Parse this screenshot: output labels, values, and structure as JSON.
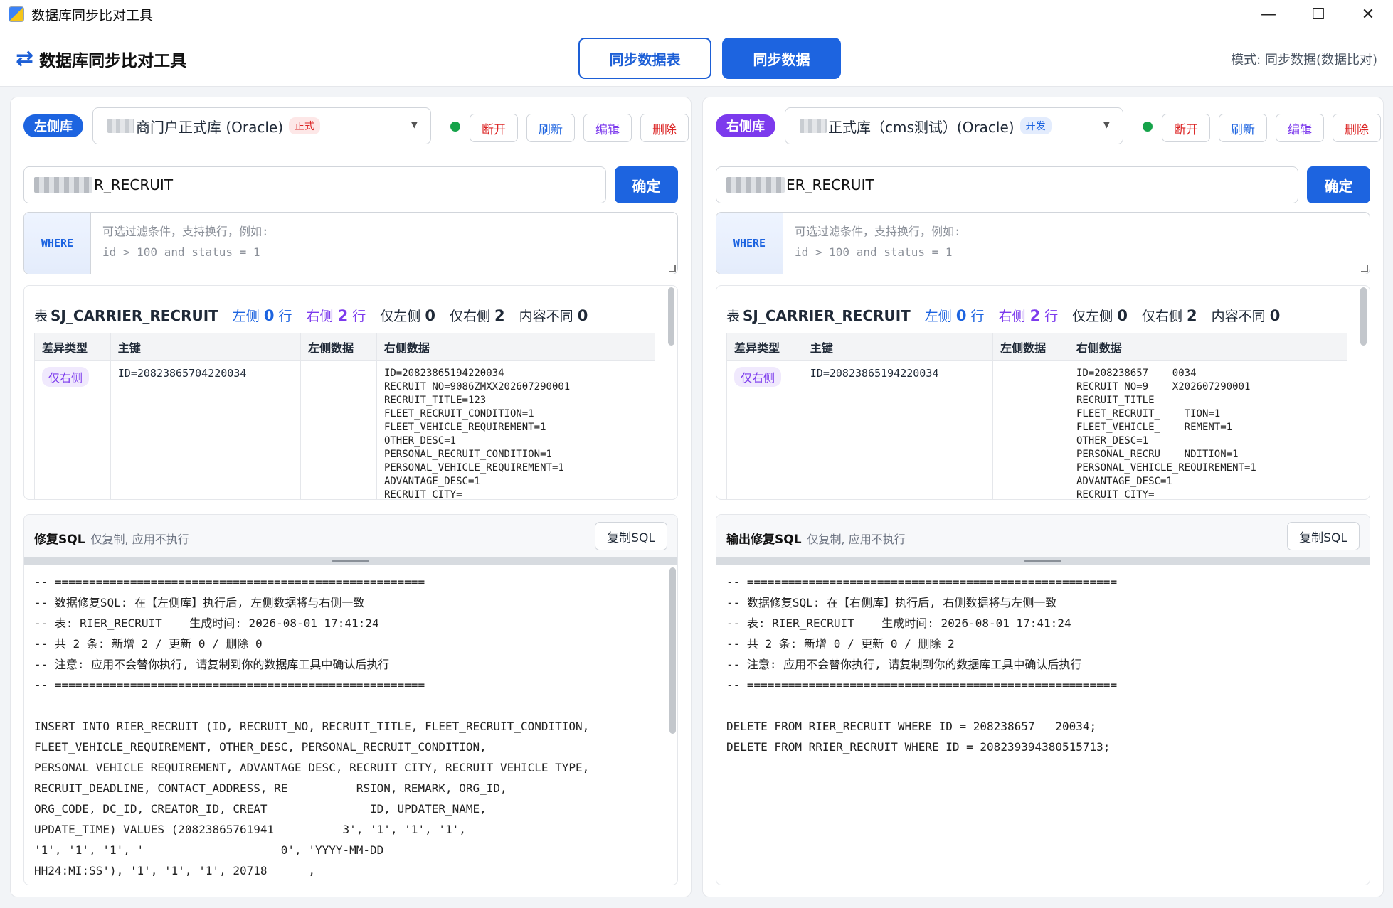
{
  "window": {
    "title": "数据库同步比对工具",
    "min": "—",
    "max": "☐",
    "close": "✕"
  },
  "header": {
    "brand": "数据库同步比对工具",
    "tabs": [
      {
        "label": "同步数据表"
      },
      {
        "label": "同步数据"
      }
    ],
    "mode": "模式: 同步数据(数据比对)"
  },
  "left": {
    "side_badge": "左侧库",
    "db_name": "商门户正式库 (Oracle)",
    "env": "正式",
    "status_color": "#16a34a",
    "buttons": {
      "disconnect": "断开",
      "refresh": "刷新",
      "edit": "编辑",
      "delete": "删除"
    },
    "table_input": "R_RECRUIT",
    "confirm": "确定",
    "where_label": "WHERE",
    "where_placeholder": "可选过滤条件，支持换行，例如:\nid > 100 and status = 1",
    "summary": {
      "prefix": "表",
      "table": "SJ_CARRIER_RECRUIT",
      "left_label": "左侧",
      "left_count": "0",
      "left_unit": "行",
      "right_label": "右侧",
      "right_count": "2",
      "right_unit": "行",
      "only_left_label": "仅左侧",
      "only_left": "0",
      "only_right_label": "仅右侧",
      "only_right": "2",
      "diff_label": "内容不同",
      "diff": "0"
    },
    "columns": [
      "差异类型",
      "主键",
      "左侧数据",
      "右侧数据"
    ],
    "row": {
      "type": "仅右侧",
      "pk": "ID=20823865704220034",
      "right_data": "ID=20823865194220034\nRECRUIT_NO=9086ZMXX202607290001\nRECRUIT_TITLE=123\nFLEET_RECRUIT_CONDITION=1\nFLEET_VEHICLE_REQUIREMENT=1\nOTHER_DESC=1\nPERSONAL_RECRUIT_CONDITION=1\nPERSONAL_VEHICLE_REQUIREMENT=1\nADVANTAGE_DESC=1\nRECRUIT_CITY="
    },
    "sql": {
      "title": "修复SQL",
      "subtitle": "仅复制, 应用不执行",
      "copy": "复制SQL",
      "code": "-- ======================================================\n-- 数据修复SQL: 在【左侧库】执行后, 左侧数据将与右侧一致\n-- 表: RIER_RECRUIT    生成时间: 2026-08-01 17:41:24\n-- 共 2 条: 新增 2 / 更新 0 / 删除 0\n-- 注意: 应用不会替你执行, 请复制到你的数据库工具中确认后执行\n-- ======================================================\n\nINSERT INTO RIER_RECRUIT (ID, RECRUIT_NO, RECRUIT_TITLE, FLEET_RECRUIT_CONDITION,\nFLEET_VEHICLE_REQUIREMENT, OTHER_DESC, PERSONAL_RECRUIT_CONDITION,\nPERSONAL_VEHICLE_REQUIREMENT, ADVANTAGE_DESC, RECRUIT_CITY, RECRUIT_VEHICLE_TYPE,\nRECRUIT_DEADLINE, CONTACT_ADDRESS, RE          RSION, REMARK, ORG_ID,\nORG_CODE, DC_ID, CREATOR_ID, CREAT               ID, UPDATER_NAME,\nUPDATE_TIME) VALUES (20823865761941          3', '1', '1', '1',\n'1', '1', '1', '                    0', 'YYYY-MM-DD\nHH24:MI:SS'), '1', '1', '1', 20718      ,"
    }
  },
  "right": {
    "side_badge": "右侧库",
    "db_name": "正式库（cms测试）(Oracle)",
    "env": "开发",
    "status_color": "#16a34a",
    "buttons": {
      "disconnect": "断开",
      "refresh": "刷新",
      "edit": "编辑",
      "delete": "删除"
    },
    "table_input": "ER_RECRUIT",
    "confirm": "确定",
    "where_label": "WHERE",
    "where_placeholder": "可选过滤条件，支持换行，例如:\nid > 100 and status = 1",
    "summary": {
      "prefix": "表",
      "table": "SJ_CARRIER_RECRUIT",
      "left_label": "左侧",
      "left_count": "0",
      "left_unit": "行",
      "right_label": "右侧",
      "right_count": "2",
      "right_unit": "行",
      "only_left_label": "仅左侧",
      "only_left": "0",
      "only_right_label": "仅右侧",
      "only_right": "2",
      "diff_label": "内容不同",
      "diff": "0"
    },
    "columns": [
      "差异类型",
      "主键",
      "左侧数据",
      "右侧数据"
    ],
    "row": {
      "type": "仅右侧",
      "pk": "ID=20823865194220034",
      "right_data": "ID=208238657    0034\nRECRUIT_NO=9    X202607290001\nRECRUIT_TITLE\nFLEET_RECRUIT_    TION=1\nFLEET_VEHICLE_    REMENT=1\nOTHER_DESC=1\nPERSONAL_RECRU    NDITION=1\nPERSONAL_VEHICLE_REQUIREMENT=1\nADVANTAGE_DESC=1\nRECRUIT_CITY="
    },
    "sql": {
      "title": "输出修复SQL",
      "subtitle": "仅复制, 应用不执行",
      "copy": "复制SQL",
      "code": "-- ======================================================\n-- 数据修复SQL: 在【右侧库】执行后, 右侧数据将与左侧一致\n-- 表: RIER_RECRUIT    生成时间: 2026-08-01 17:41:24\n-- 共 2 条: 新增 0 / 更新 0 / 删除 2\n-- 注意: 应用不会替你执行, 请复制到你的数据库工具中确认后执行\n-- ======================================================\n\nDELETE FROM RIER_RECRUIT WHERE ID = 208238657   20034;\nDELETE FROM RRIER_RECRUIT WHERE ID = 208239394380515713;"
    }
  }
}
